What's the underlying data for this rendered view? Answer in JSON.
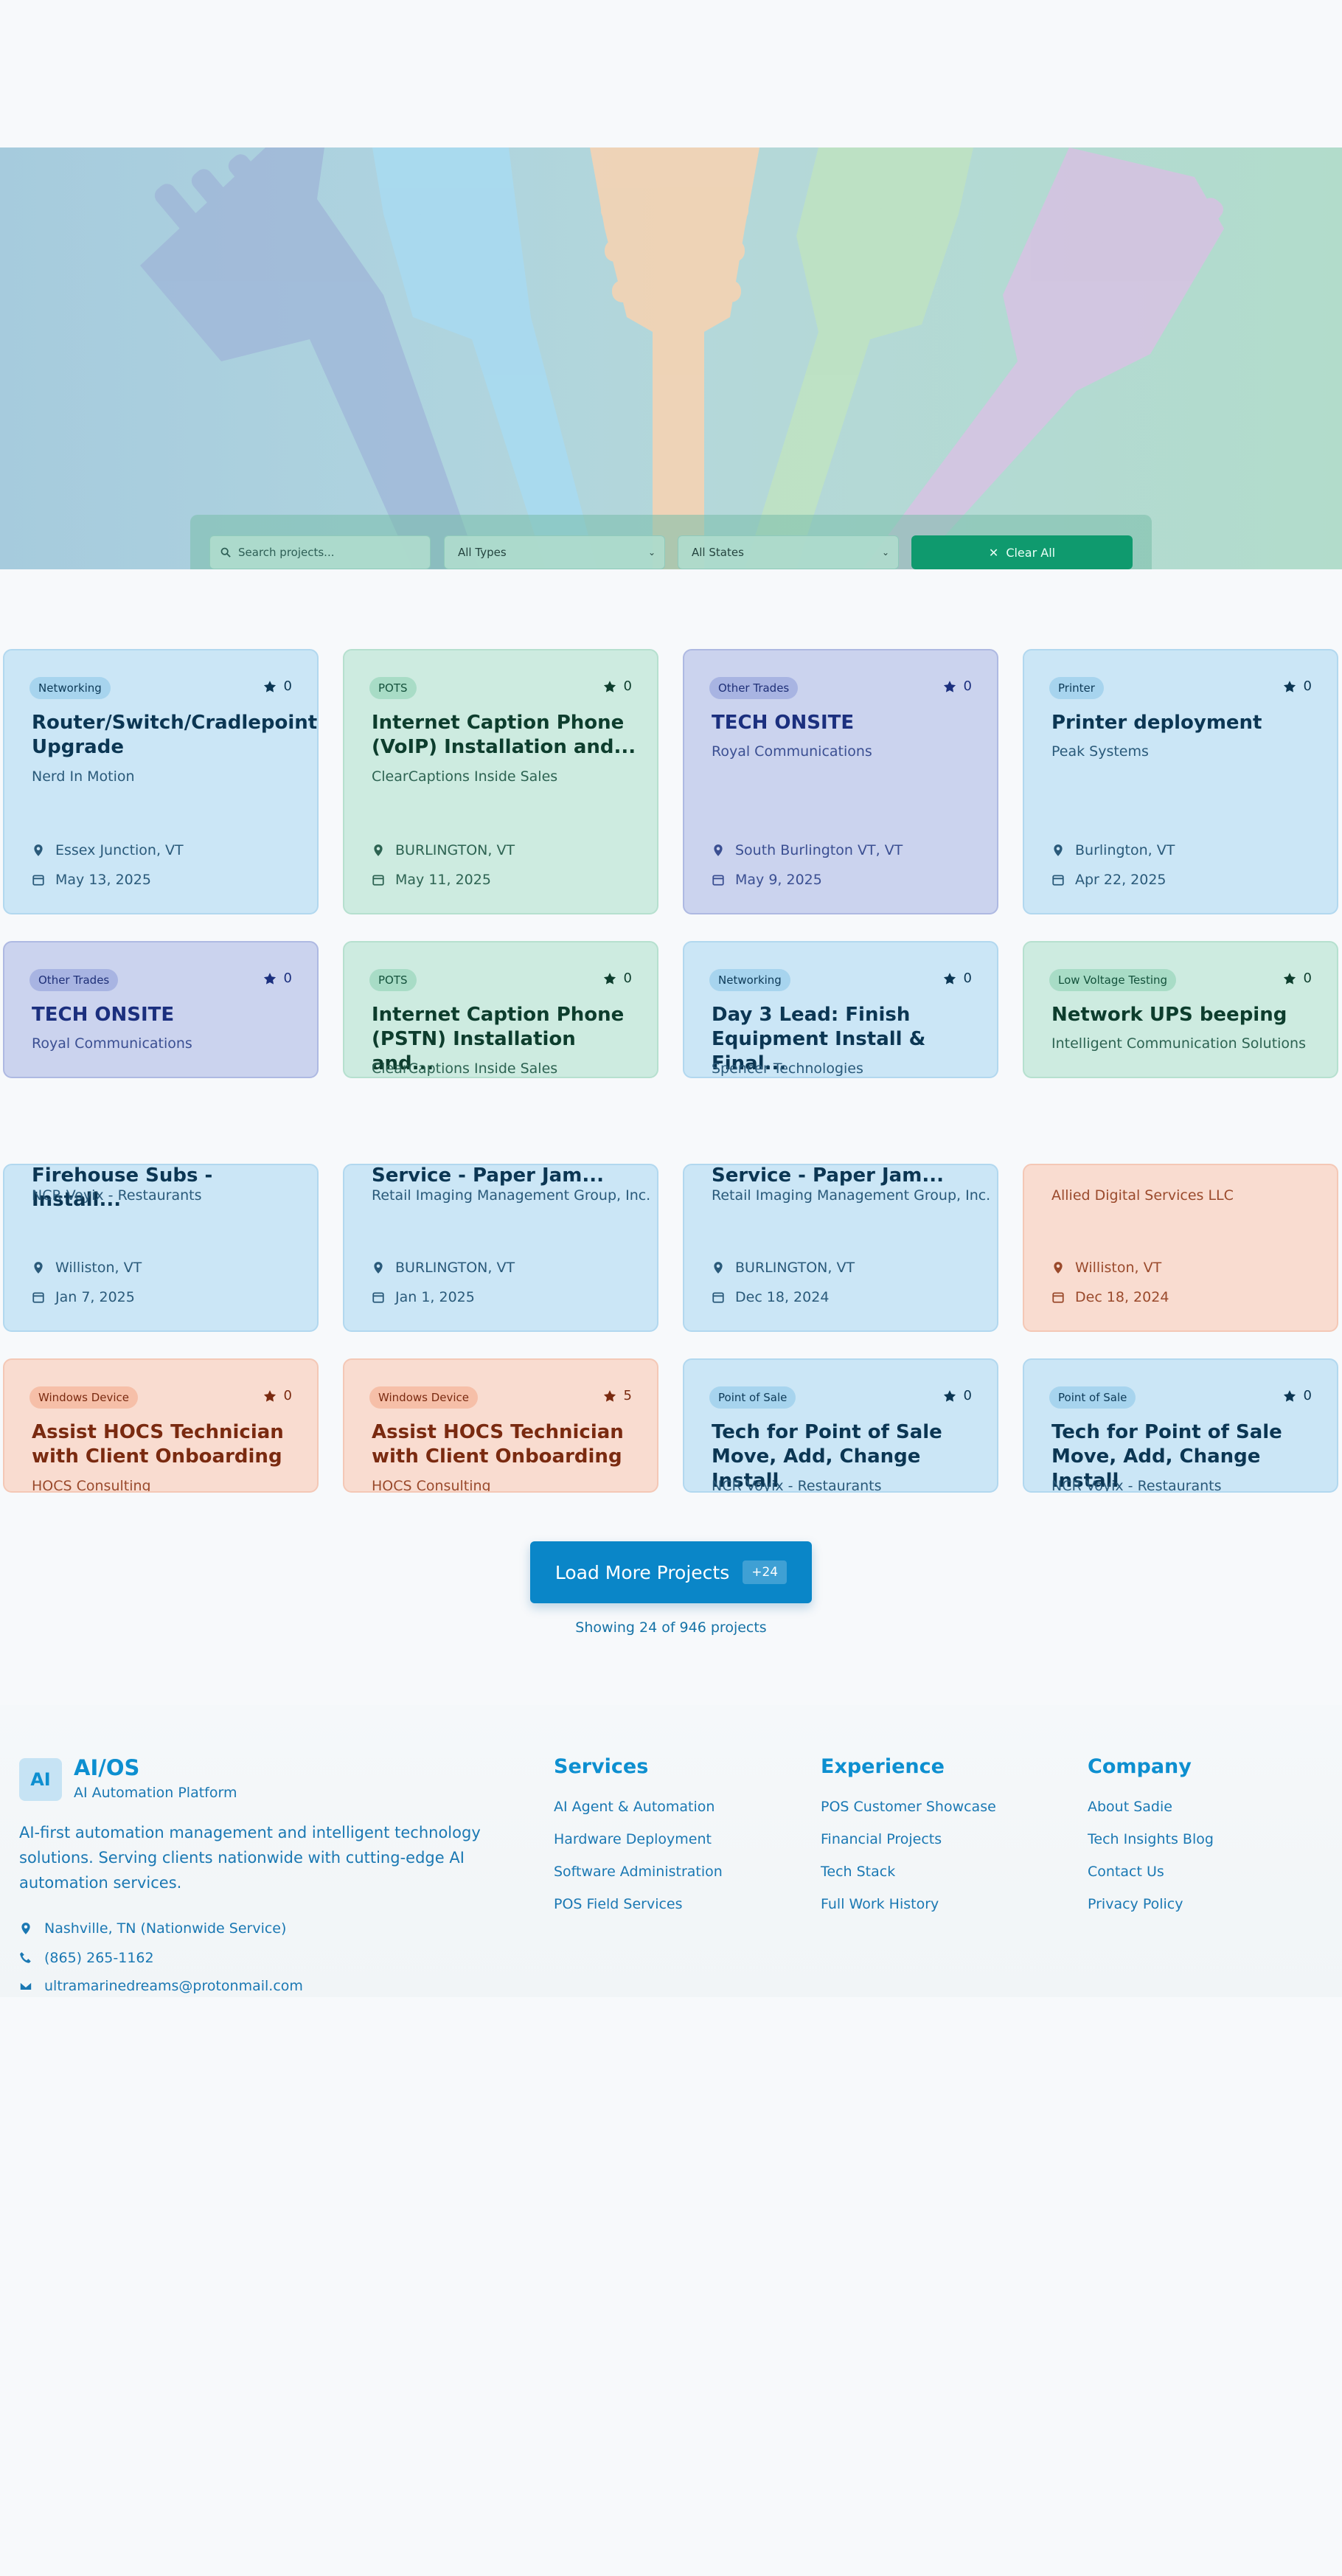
{
  "filters": {
    "search_placeholder": "Search projects...",
    "type_value": "All Types",
    "state_value": "All States",
    "clear_label": "Clear All"
  },
  "cards": [
    {
      "category": "Networking",
      "favorites": "0",
      "title": "Router/Switch/Cradlepoint Upgrade",
      "client": "Nerd In Motion",
      "location": "Essex Junction, VT",
      "date": "May 13, 2025",
      "theme": "blue"
    },
    {
      "category": "POTS",
      "favorites": "0",
      "title": "Internet Caption Phone (VoIP) Installation and...",
      "client": "ClearCaptions Inside Sales",
      "location": "BURLINGTON, VT",
      "date": "May 11, 2025",
      "theme": "green"
    },
    {
      "category": "Other Trades",
      "favorites": "0",
      "title": "TECH ONSITE",
      "client": "Royal Communications",
      "location": "South Burlington VT, VT",
      "date": "May 9, 2025",
      "theme": "indigo"
    },
    {
      "category": "Printer",
      "favorites": "0",
      "title": "Printer deployment",
      "client": "Peak Systems",
      "location": "Burlington, VT",
      "date": "Apr 22, 2025",
      "theme": "blue"
    },
    {
      "category": "Other Trades",
      "favorites": "0",
      "title": "TECH ONSITE",
      "client": "Royal Communications",
      "theme": "indigo"
    },
    {
      "category": "POTS",
      "favorites": "0",
      "title": "Internet Caption Phone (PSTN) Installation and...",
      "client": "ClearCaptions Inside Sales",
      "theme": "green"
    },
    {
      "category": "Networking",
      "favorites": "0",
      "title": "Day 3 Lead: Finish Equipment Install & Final...",
      "client": "Spencer Technologies",
      "theme": "blue"
    },
    {
      "category": "Low Voltage Testing",
      "favorites": "0",
      "title": "Network UPS beeping",
      "client": "Intelligent Communication Solutions",
      "theme": "green"
    },
    {
      "title": "Firehouse Subs - Install...",
      "client": "NCR Voyix - Restaurants",
      "location": "Williston, VT",
      "date": "Jan 7, 2025",
      "theme": "blue"
    },
    {
      "title": "Service - Paper Jam...",
      "client": "Retail Imaging Management Group, Inc.",
      "location": "BURLINGTON, VT",
      "date": "Jan 1, 2025",
      "theme": "blue"
    },
    {
      "title": "Service - Paper Jam...",
      "client": "Retail Imaging Management Group, Inc.",
      "location": "BURLINGTON, VT",
      "date": "Dec 18, 2024",
      "theme": "blue"
    },
    {
      "client": "Allied Digital Services LLC",
      "location": "Williston, VT",
      "date": "Dec 18, 2024",
      "theme": "peach"
    },
    {
      "category": "Windows Device",
      "favorites": "0",
      "title": "Assist HOCS Technician with Client Onboarding",
      "client": "HOCS Consulting",
      "theme": "peach"
    },
    {
      "category": "Windows Device",
      "favorites": "5",
      "title": "Assist HOCS Technician with Client Onboarding",
      "client": "HOCS Consulting",
      "theme": "peach"
    },
    {
      "category": "Point of Sale",
      "favorites": "0",
      "title": "Tech for Point of Sale Move, Add, Change Install",
      "client": "NCR Voyix - Restaurants",
      "theme": "blue"
    },
    {
      "category": "Point of Sale",
      "favorites": "0",
      "title": "Tech for Point of Sale Move, Add, Change Install",
      "client": "NCR Voyix - Restaurants",
      "theme": "blue"
    }
  ],
  "load_more": {
    "label": "Load More Projects",
    "count": "+24",
    "showing": "Showing 24 of 946 projects"
  },
  "footer": {
    "logo": "AI",
    "brand": "AI/OS",
    "tagline": "AI Automation Platform",
    "description": "AI-first automation management and intelligent technology solutions. Serving clients nationwide with cutting-edge AI automation services.",
    "location": "Nashville, TN (Nationwide Service)",
    "phone": "(865) 265-1162",
    "email": "ultramarinedreams@protonmail.com",
    "columns": [
      {
        "heading": "Services",
        "links": [
          "AI Agent & Automation",
          "Hardware Deployment",
          "Software Administration",
          "POS Field Services"
        ]
      },
      {
        "heading": "Experience",
        "links": [
          "POS Customer Showcase",
          "Financial Projects",
          "Tech Stack",
          "Full Work History"
        ]
      },
      {
        "heading": "Company",
        "links": [
          "About Sadie",
          "Tech Insights Blog",
          "Contact Us",
          "Privacy Policy"
        ]
      }
    ]
  }
}
